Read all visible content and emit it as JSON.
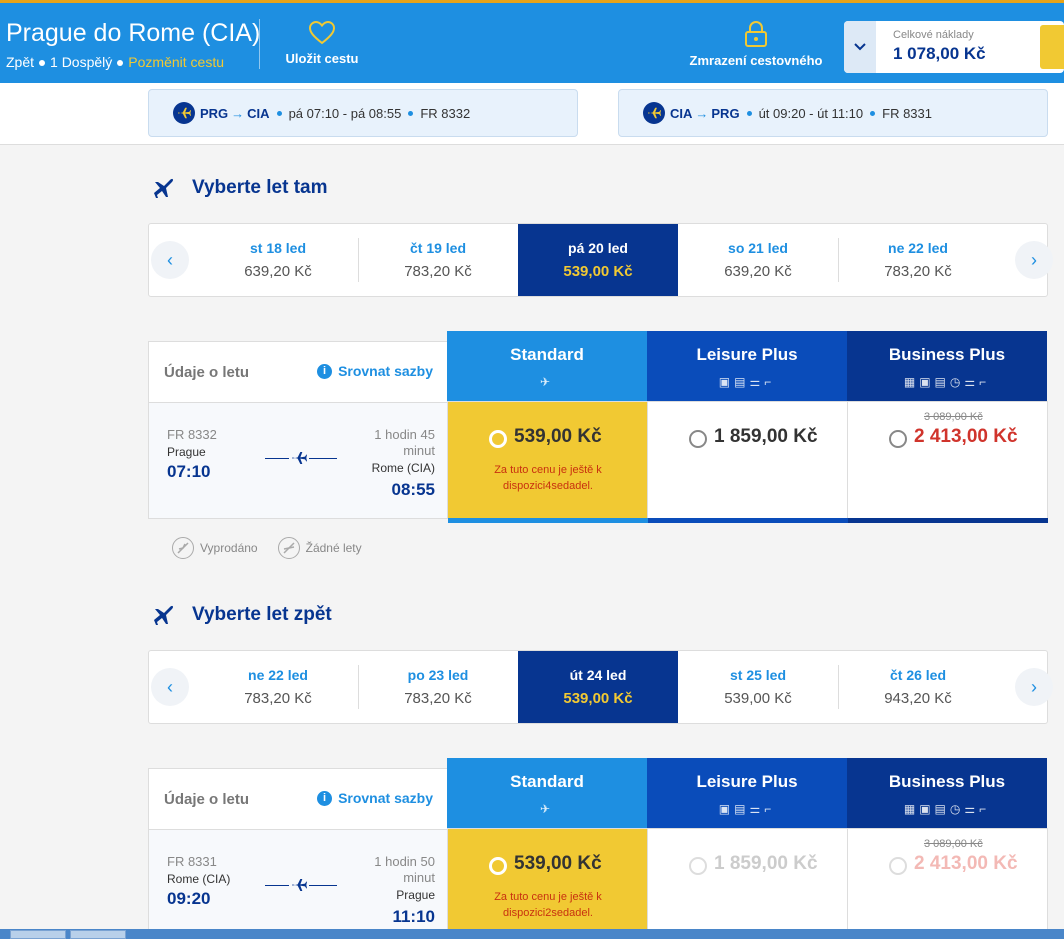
{
  "header": {
    "title": "Prague do Rome (CIA)",
    "back": "Zpět",
    "passengers": "1 Dospělý",
    "change": "Pozměnit cestu",
    "save_trip": "Uložit cestu",
    "freeze": "Zmrazení cestovného",
    "total_label": "Celkové náklady",
    "total_value": "1 078,00 Kč"
  },
  "chips": {
    "out": {
      "from": "PRG",
      "to": "CIA",
      "time": "pá 07:10 - pá 08:55",
      "flight": "FR 8332"
    },
    "ret": {
      "from": "CIA",
      "to": "PRG",
      "time": "út 09:20 - út 11:10",
      "flight": "FR 8331"
    }
  },
  "outbound": {
    "title": "Vyberte let tam",
    "dates": [
      {
        "day": "st 18 led",
        "price": "639,20 Kč"
      },
      {
        "day": "čt 19 led",
        "price": "783,20 Kč"
      },
      {
        "day": "pá 20 led",
        "price": "539,00 Kč"
      },
      {
        "day": "so 21 led",
        "price": "639,20 Kč"
      },
      {
        "day": "ne 22 led",
        "price": "783,20 Kč"
      }
    ],
    "info_title": "Údaje o letu",
    "compare": "Srovnat sazby",
    "flight": "FR 8332",
    "from": "Prague",
    "dep": "07:10",
    "duration_1": "1 hodin 45",
    "duration_2": "minut",
    "to": "Rome (CIA)",
    "arr": "08:55",
    "fares": {
      "standard": {
        "name": "Standard",
        "price": "539,00 Kč",
        "note_1": "Za tuto cenu je ještě k",
        "note_2": "dispozici4sedadel."
      },
      "leisure": {
        "name": "Leisure Plus",
        "price": "1 859,00 Kč"
      },
      "business": {
        "name": "Business Plus",
        "old": "3 089,00 Kč",
        "price": "2 413,00 Kč"
      }
    },
    "legend": {
      "sold": "Vyprodáno",
      "none": "Žádné lety"
    }
  },
  "inbound": {
    "title": "Vyberte let zpět",
    "dates": [
      {
        "day": "ne 22 led",
        "price": "783,20 Kč"
      },
      {
        "day": "po 23 led",
        "price": "783,20 Kč"
      },
      {
        "day": "út 24 led",
        "price": "539,00 Kč"
      },
      {
        "day": "st 25 led",
        "price": "539,00 Kč"
      },
      {
        "day": "čt 26 led",
        "price": "943,20 Kč"
      }
    ],
    "info_title": "Údaje o letu",
    "compare": "Srovnat sazby",
    "flight": "FR 8331",
    "from": "Rome (CIA)",
    "dep": "09:20",
    "duration_1": "1 hodin 50",
    "duration_2": "minut",
    "to": "Prague",
    "arr": "11:10",
    "fares": {
      "standard": {
        "name": "Standard",
        "price": "539,00 Kč",
        "note_1": "Za tuto cenu je ještě k",
        "note_2": "dispozici2sedadel."
      },
      "leisure": {
        "name": "Leisure Plus",
        "price": "1 859,00 Kč"
      },
      "business": {
        "name": "Business Plus",
        "old": "3 089,00 Kč",
        "price": "2 413,00 Kč"
      }
    }
  },
  "icons": {
    "plane": "plane-icon",
    "heart": "heart-icon",
    "lock": "lock-icon",
    "info": "info-icon",
    "chevron": "chevron-icon"
  },
  "colors": {
    "brand_blue": "#073590",
    "light_blue": "#1e8fe1",
    "yellow": "#f1c933",
    "red": "#d0342c"
  }
}
